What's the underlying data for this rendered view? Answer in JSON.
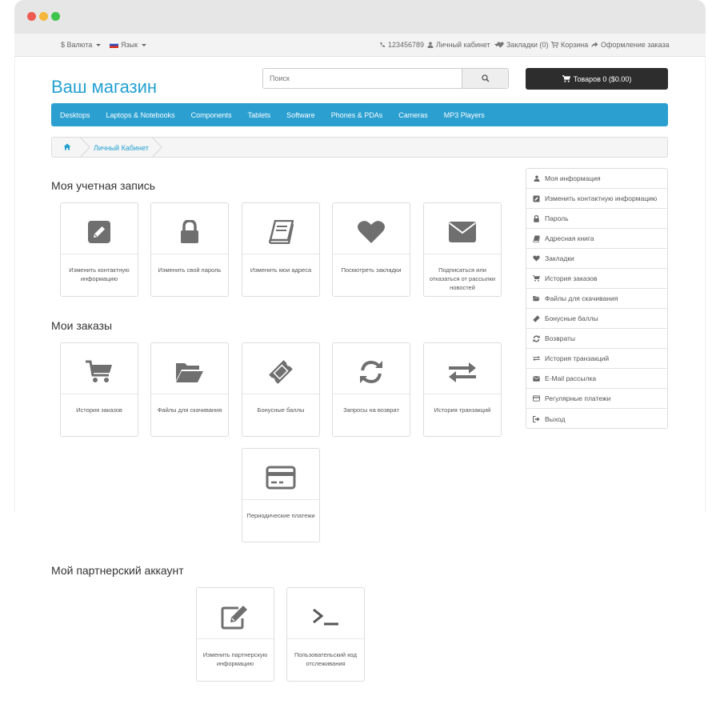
{
  "topbar": {
    "currency": "$ Валюта",
    "language": "Язык",
    "phone": "123456789",
    "account": "Личный кабинет",
    "wishlist": "Закладки (0)",
    "cart": "Корзина",
    "checkout": "Оформление заказа"
  },
  "header": {
    "logo": "Ваш магазин",
    "search_placeholder": "Поиск",
    "cart_button": "Товаров 0 ($0.00)"
  },
  "menu": [
    "Desktops",
    "Laptops & Notebooks",
    "Components",
    "Tablets",
    "Software",
    "Phones & PDAs",
    "Cameras",
    "MP3 Players"
  ],
  "breadcrumb": {
    "current": "Личный Кабинет"
  },
  "sections": {
    "account": "Моя учетная запись",
    "orders": "Мои заказы",
    "affiliate": "Мой партнерский аккаунт"
  },
  "account_tiles": [
    {
      "icon": "edit-square-icon",
      "label": "Изменить контактную информацию"
    },
    {
      "icon": "lock-icon",
      "label": "Изменить свой пароль"
    },
    {
      "icon": "book-icon",
      "label": "Изменить мои адреса"
    },
    {
      "icon": "heart-icon",
      "label": "Посмотреть закладки"
    },
    {
      "icon": "envelope-icon",
      "label": "Подписаться или отказаться от рассылки новостей"
    }
  ],
  "order_tiles": [
    {
      "icon": "cart-icon",
      "label": "История заказов"
    },
    {
      "icon": "folder-icon",
      "label": "Файлы для скачивания"
    },
    {
      "icon": "ticket-icon",
      "label": "Бонусные баллы"
    },
    {
      "icon": "refresh-icon",
      "label": "Запросы на возврат"
    },
    {
      "icon": "exchange-icon",
      "label": "История транзакций"
    },
    {
      "icon": "credit-card-icon",
      "label": "Периодические платежи"
    }
  ],
  "affiliate_tiles": [
    {
      "icon": "edit-pencil-icon",
      "label": "Изменить партнерскую информацию"
    },
    {
      "icon": "terminal-icon",
      "label": "Пользовательский код отслеживания"
    }
  ],
  "sidebar": [
    {
      "icon": "user-icon",
      "label": "Моя информация"
    },
    {
      "icon": "edit-square-icon",
      "label": "Изменить контактную информацию"
    },
    {
      "icon": "lock-icon",
      "label": "Пароль"
    },
    {
      "icon": "book-icon",
      "label": "Адресная книга"
    },
    {
      "icon": "heart-icon",
      "label": "Закладки"
    },
    {
      "icon": "cart-icon",
      "label": "История заказов"
    },
    {
      "icon": "folder-icon",
      "label": "Файлы для скачивания"
    },
    {
      "icon": "ticket-icon",
      "label": "Бонусные баллы"
    },
    {
      "icon": "refresh-icon",
      "label": "Возвраты"
    },
    {
      "icon": "exchange-icon",
      "label": "История транзакций"
    },
    {
      "icon": "envelope-icon",
      "label": "E-Mail рассылка"
    },
    {
      "icon": "credit-card-icon",
      "label": "Регулярные платежи"
    },
    {
      "icon": "sign-out-icon",
      "label": "Выход"
    }
  ],
  "colors": {
    "accent": "#23a1d1",
    "menu_bg": "#2a9fd0",
    "cart_bg": "#2d2d2d",
    "icon_gray": "#6f6f6f",
    "dot_red": "#ee5a52",
    "dot_yellow": "#f5b73b",
    "dot_green": "#3ec44a"
  }
}
